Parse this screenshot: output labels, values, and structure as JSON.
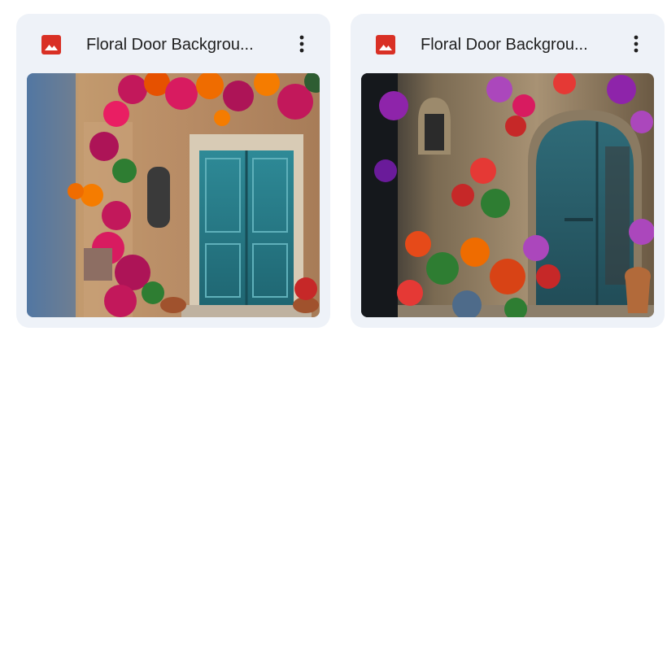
{
  "files": [
    {
      "title": "Floral Door Backgrou...",
      "icon": "image-file-icon",
      "more_icon": "more-vertical-icon",
      "thumbnail": "photo-blue-door-flowers"
    },
    {
      "title": "Floral Door Backgrou...",
      "icon": "image-file-icon",
      "more_icon": "more-vertical-icon",
      "thumbnail": "photo-arched-door-flowers"
    }
  ],
  "colors": {
    "card_bg": "#eef2f8",
    "icon_red": "#d93025",
    "text": "#1f1f1f"
  }
}
